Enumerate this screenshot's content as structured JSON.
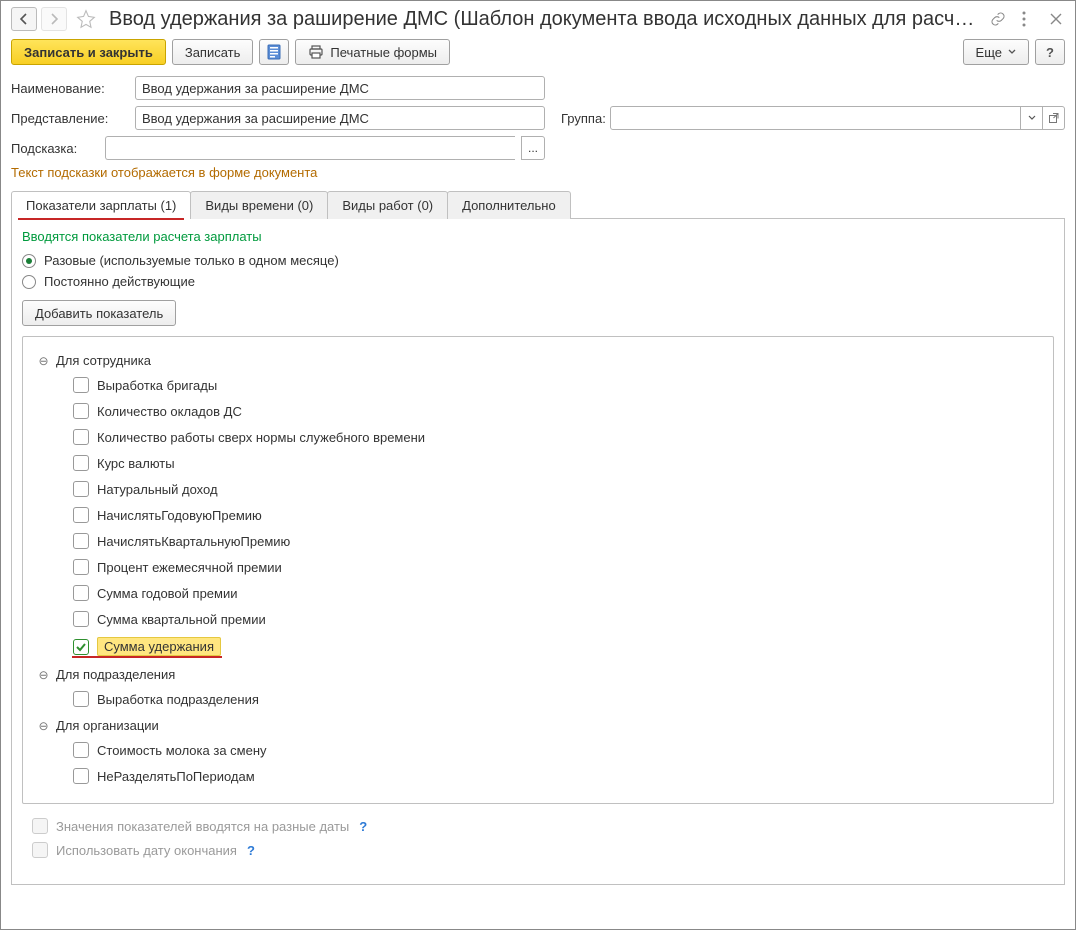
{
  "header": {
    "title": "Ввод удержания за раширение ДМС (Шаблон документа ввода исходных данных для расчета з..."
  },
  "toolbar": {
    "save_close": "Записать и закрыть",
    "save": "Записать",
    "print_forms": "Печатные формы",
    "more": "Еще"
  },
  "fields": {
    "name_label": "Наименование:",
    "name_value": "Ввод удержания за расширение ДМС",
    "present_label": "Представление:",
    "present_value": "Ввод удержания за расширение ДМС",
    "group_label": "Группа:",
    "group_value": "",
    "hint_label": "Подсказка:",
    "hint_value": "",
    "hint_ellipsis": "...",
    "hint_note": "Текст подсказки отображается в форме документа"
  },
  "tabs": {
    "t0": "Показатели зарплаты (1)",
    "t1": "Виды времени (0)",
    "t2": "Виды работ (0)",
    "t3": "Дополнительно"
  },
  "panel": {
    "heading": "Вводятся показатели расчета зарплаты",
    "radio_once": "Разовые (используемые только в одном месяце)",
    "radio_const": "Постоянно действующие",
    "add_btn": "Добавить показатель"
  },
  "tree": {
    "g0": {
      "label": "Для сотрудника",
      "items": [
        {
          "label": "Выработка бригады",
          "checked": false
        },
        {
          "label": "Количество окладов ДС",
          "checked": false
        },
        {
          "label": "Количество работы сверх нормы служебного времени",
          "checked": false
        },
        {
          "label": "Курс валюты",
          "checked": false
        },
        {
          "label": "Натуральный доход",
          "checked": false
        },
        {
          "label": "НачислятьГодовуюПремию",
          "checked": false
        },
        {
          "label": "НачислятьКвартальнуюПремию",
          "checked": false
        },
        {
          "label": "Процент ежемесячной премии",
          "checked": false
        },
        {
          "label": "Сумма годовой премии",
          "checked": false
        },
        {
          "label": "Сумма квартальной премии",
          "checked": false
        },
        {
          "label": "Сумма удержания",
          "checked": true
        }
      ]
    },
    "g1": {
      "label": "Для подразделения",
      "items": [
        {
          "label": "Выработка подразделения",
          "checked": false
        }
      ]
    },
    "g2": {
      "label": "Для организации",
      "items": [
        {
          "label": "Стоимость молока за смену",
          "checked": false
        },
        {
          "label": "НеРазделятьПоПериодам",
          "checked": false
        }
      ]
    }
  },
  "footer": {
    "opt1": "Значения показателей вводятся на разные даты",
    "opt2": "Использовать дату окончания"
  }
}
